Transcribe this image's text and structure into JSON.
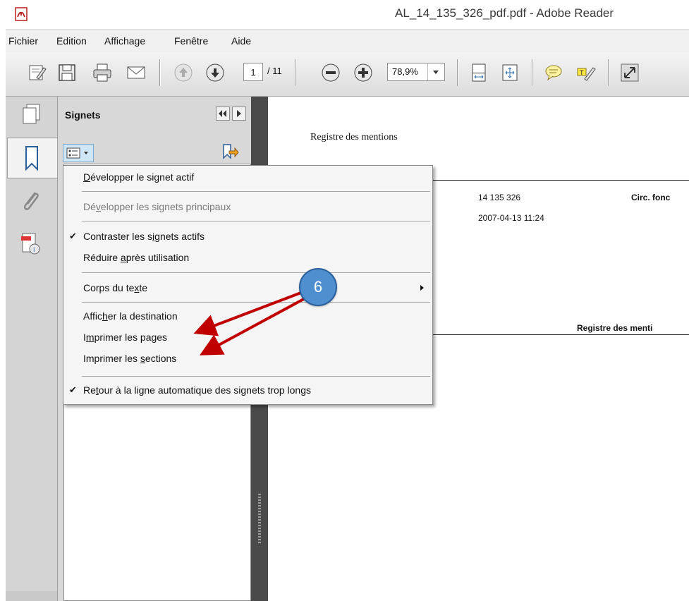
{
  "window": {
    "title": "AL_14_135_326_pdf.pdf - Adobe Reader"
  },
  "menubar": {
    "items": [
      "Fichier",
      "Edition",
      "Affichage",
      "Fenêtre",
      "Aide"
    ]
  },
  "toolbar": {
    "page_current": "1",
    "page_total": "/ 11",
    "zoom": "78,9%",
    "icons": [
      "edit-icon",
      "save-icon",
      "print-icon",
      "email-icon",
      "page-up-icon",
      "page-down-icon",
      "zoom-out-icon",
      "zoom-in-icon",
      "zoom-dropdown-icon",
      "fit-page-icon",
      "fit-width-icon",
      "comment-icon",
      "highlight-icon",
      "fullscreen-icon"
    ]
  },
  "leftrail": {
    "icons": [
      "pages-icon",
      "bookmarks-icon",
      "attachments-icon",
      "security-icon"
    ]
  },
  "panel": {
    "title": "Signets"
  },
  "dropdown": {
    "items": [
      {
        "pre": "",
        "ul": "D",
        "post": "évelopper le signet actif",
        "checked": false,
        "disabled": false
      },
      {
        "pre": "Dé",
        "ul": "v",
        "post": "elopper les signets principaux",
        "checked": false,
        "disabled": true
      },
      {
        "pre": "Contraster les s",
        "ul": "i",
        "post": "gnets actifs",
        "checked": true,
        "disabled": false
      },
      {
        "pre": "Réduire ",
        "ul": "a",
        "post": "près utilisation",
        "checked": false,
        "disabled": false
      },
      {
        "pre": "Corps du te",
        "ul": "x",
        "post": "te",
        "checked": false,
        "disabled": false
      },
      {
        "pre": "Affic",
        "ul": "h",
        "post": "er la destination",
        "checked": false,
        "disabled": false
      },
      {
        "pre": "I",
        "ul": "m",
        "post": "primer les pages",
        "checked": false,
        "disabled": false
      },
      {
        "pre": "Imprimer les ",
        "ul": "s",
        "post": "ections",
        "checked": false,
        "disabled": false
      },
      {
        "pre": "Re",
        "ul": "t",
        "post": "our à la ligne automatique des signets trop longs",
        "checked": true,
        "disabled": false
      }
    ]
  },
  "document": {
    "header": "Registre des mentions",
    "ref": "14 135 326",
    "datetime": "2007-04-13 11:24",
    "circ": "Circ. fonc",
    "section_title": "Registre des menti"
  },
  "annotation": {
    "step": "6"
  },
  "colors": {
    "badge": "#4f8fd0",
    "arrow": "#c00000"
  }
}
